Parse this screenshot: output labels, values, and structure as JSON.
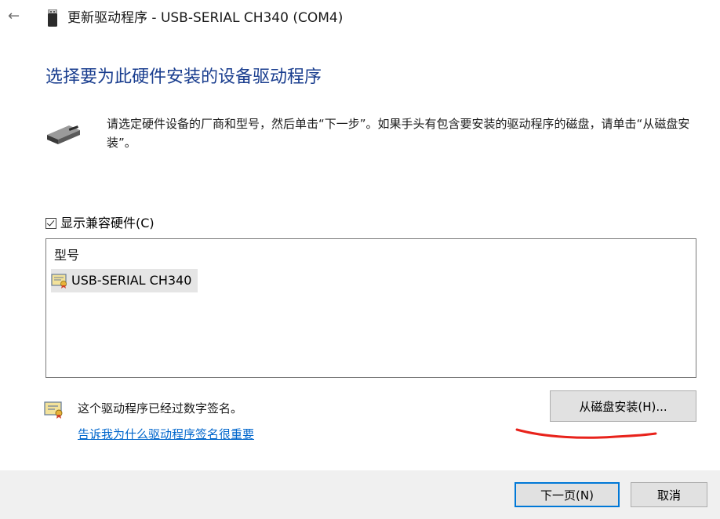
{
  "window": {
    "title": "更新驱动程序 - USB-SERIAL CH340 (COM4)",
    "back_glyph": "←"
  },
  "heading": "选择要为此硬件安装的设备驱动程序",
  "instructions": "请选定硬件设备的厂商和型号，然后单击“下一步”。如果手头有包含要安装的驱动程序的磁盘，请单击“从磁盘安装”。",
  "compat": {
    "label": "显示兼容硬件(C)",
    "checked": true
  },
  "model_list": {
    "header": "型号",
    "items": [
      "USB-SERIAL CH340"
    ]
  },
  "signature": {
    "text": "这个驱动程序已经过数字签名。",
    "link": "告诉我为什么驱动程序签名很重要"
  },
  "buttons": {
    "have_disk": "从磁盘安装(H)...",
    "next": "下一页(N)",
    "cancel": "取消"
  },
  "colors": {
    "heading": "#1a3e8f",
    "link": "#0066cc",
    "focus_border": "#0078d7",
    "annotation": "#e8221b"
  }
}
